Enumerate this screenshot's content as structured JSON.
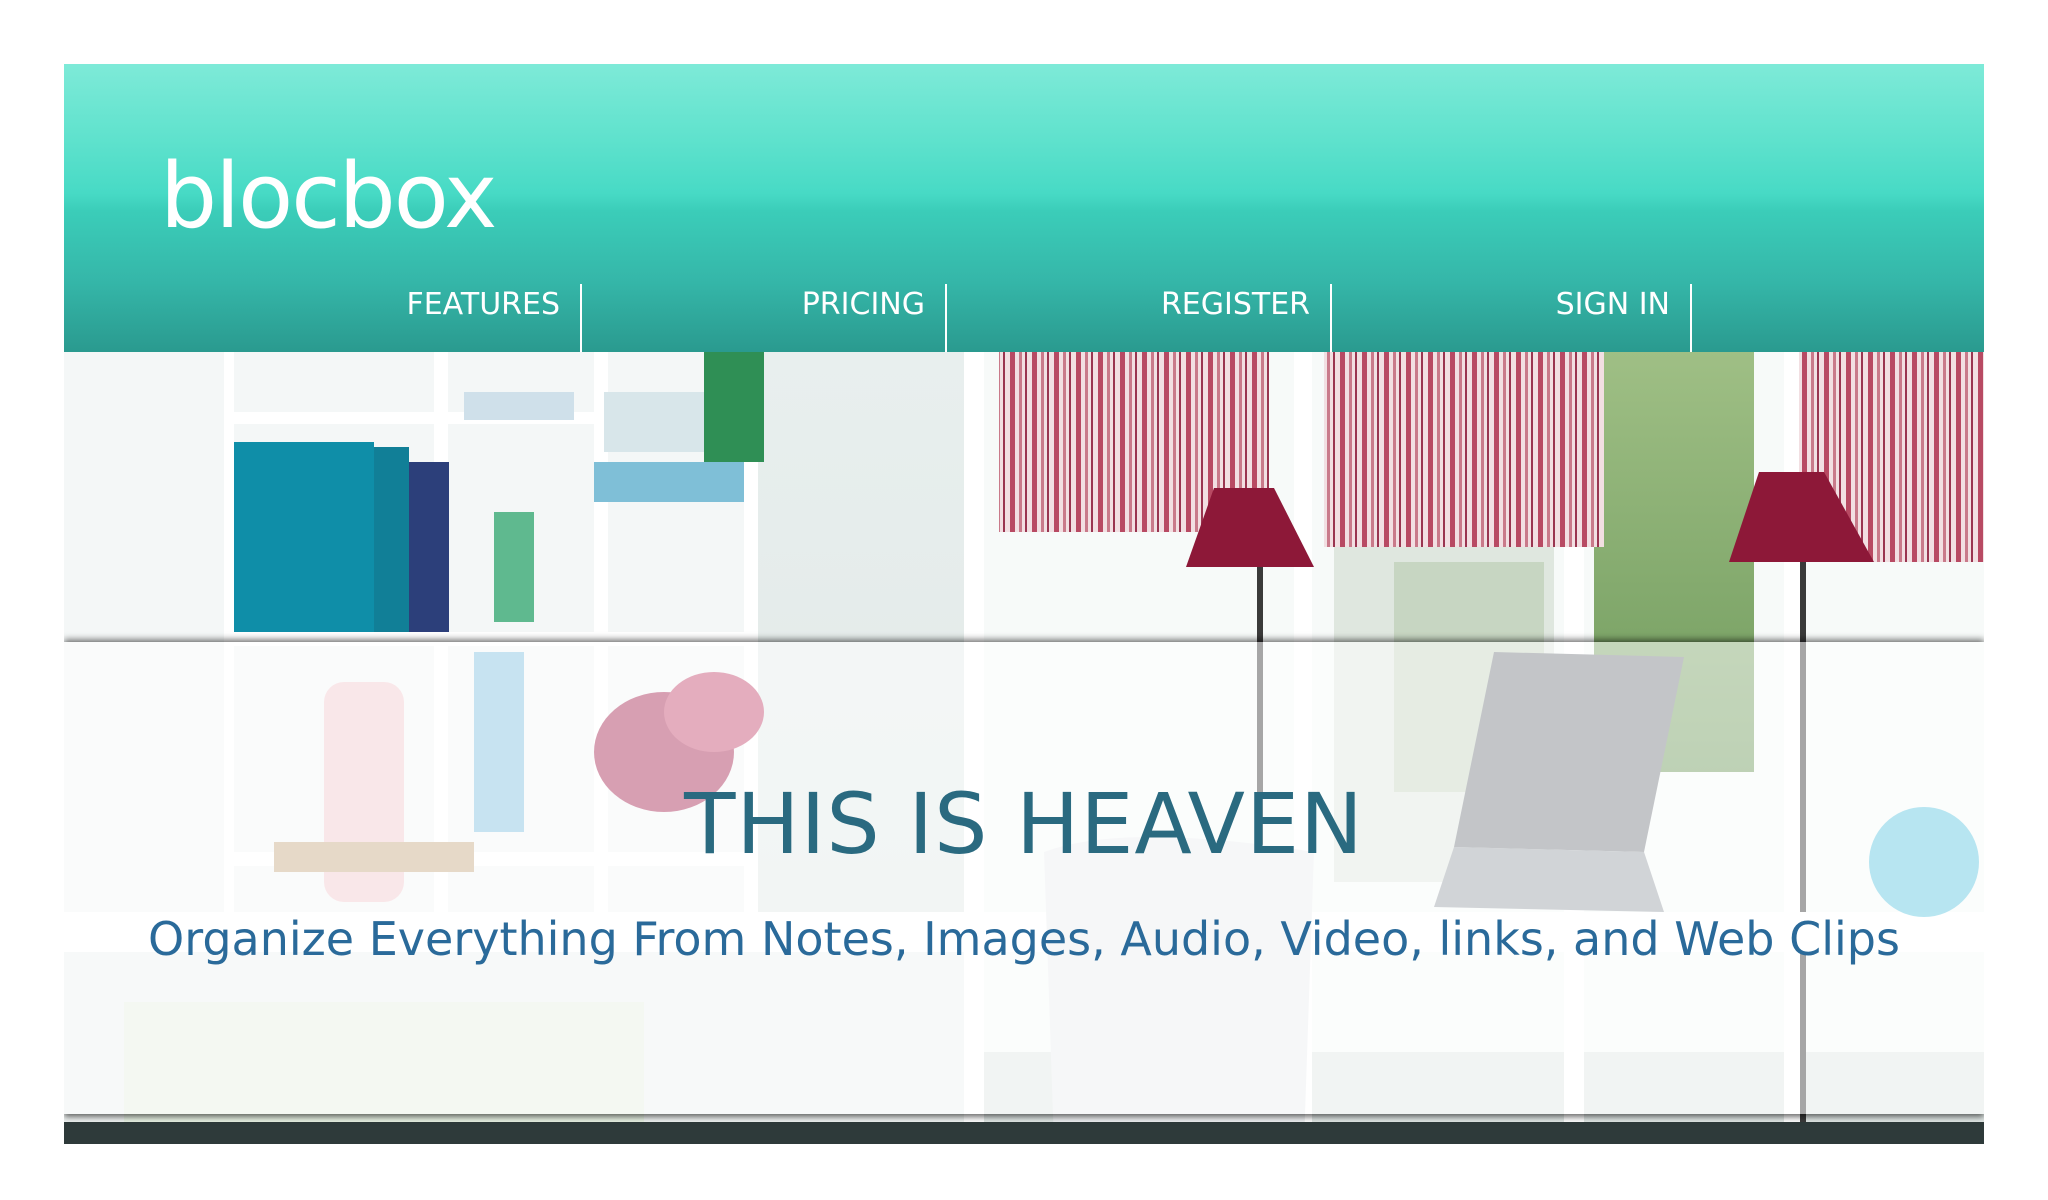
{
  "brand": {
    "logo_text": "blocbox"
  },
  "nav": {
    "items": [
      {
        "label": "FEATURES"
      },
      {
        "label": "PRICING"
      },
      {
        "label": "REGISTER"
      },
      {
        "label": "SIGN IN"
      }
    ]
  },
  "hero": {
    "title": "THIS IS HEAVEN",
    "subtitle": "Organize Everything From Notes, Images, Audio, Video, links, and Web Clips",
    "image": "home-office-photo"
  },
  "colors": {
    "header_top": "#7eead8",
    "header_bottom": "#2a9a8f",
    "title": "#2a6a80",
    "subtitle": "#2a6a9a"
  }
}
